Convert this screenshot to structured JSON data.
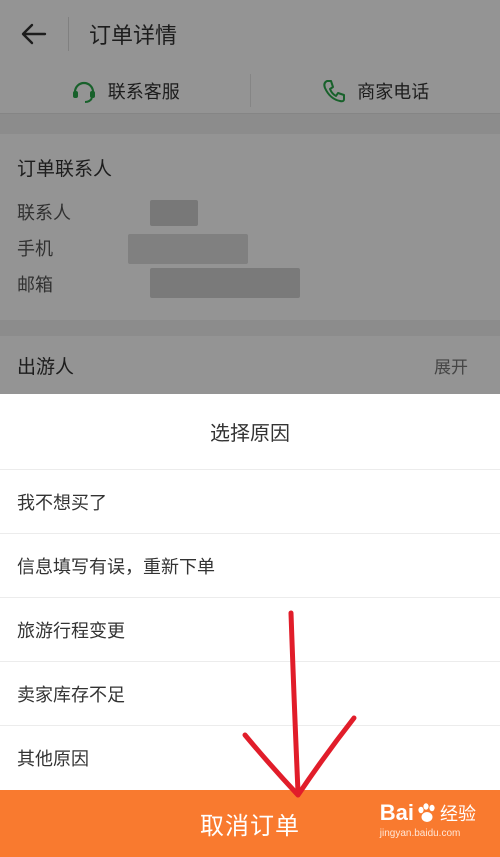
{
  "header": {
    "title": "订单详情"
  },
  "contact": {
    "service_label": "联系客服",
    "merchant_label": "商家电话"
  },
  "order_contact": {
    "title": "订单联系人",
    "fields": [
      "联系人",
      "手机",
      "邮箱"
    ]
  },
  "travelers": {
    "label": "出游人",
    "expand_label": "展开"
  },
  "reason_sheet": {
    "title": "选择原因",
    "reasons": [
      "我不想买了",
      "信息填写有误，重新下单",
      "旅游行程变更",
      "卖家库存不足",
      "其他原因"
    ]
  },
  "cancel_button": {
    "label": "取消订单"
  },
  "watermark": {
    "brand": "Bai",
    "brand_suffix": "经验",
    "url": "jingyan.baidu.com"
  },
  "colors": {
    "accent": "#f97a2f",
    "icon_green": "#2aa84a",
    "annotation_red": "#e11d2a"
  }
}
